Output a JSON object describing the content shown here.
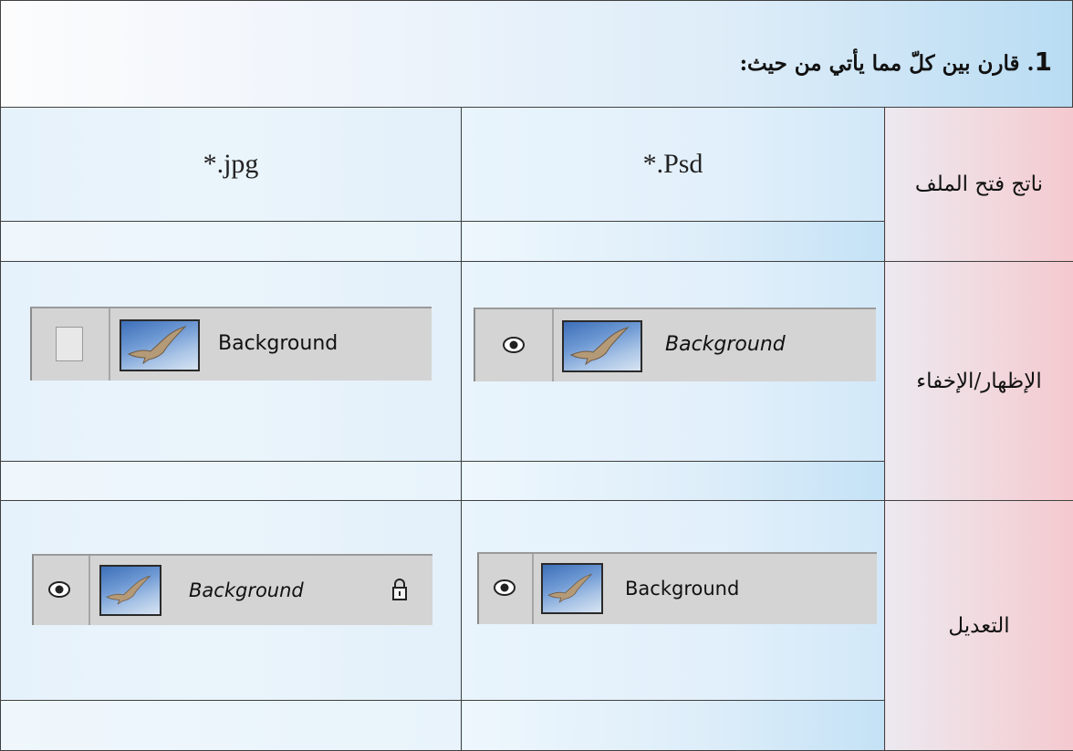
{
  "header": {
    "number": "1",
    "text": ". قارن بين كلّ مما يأتي من حيث:"
  },
  "columns": {
    "psd": "*.Psd",
    "jpg": "*.jpg"
  },
  "rows": {
    "open_result": "ناتج فتح الملف",
    "show_hide": "الإظهار/الإخفاء",
    "edit": "التعديل"
  },
  "layers": {
    "show_hide_psd": {
      "name": "Background",
      "visibility": "eye-icon",
      "italic": true
    },
    "show_hide_jpg": {
      "name": "Background",
      "visibility": "empty-checkbox",
      "italic": false
    },
    "edit_psd": {
      "name": "Background",
      "visibility": "eye-icon",
      "italic": false
    },
    "edit_jpg": {
      "name": "Background",
      "visibility": "eye-icon",
      "italic": true,
      "locked": true
    }
  },
  "colors": {
    "label_gradient_end": "#f4c9cf",
    "cell_blue": "#e3f0fa",
    "layer_gray": "#d4d4d4"
  }
}
